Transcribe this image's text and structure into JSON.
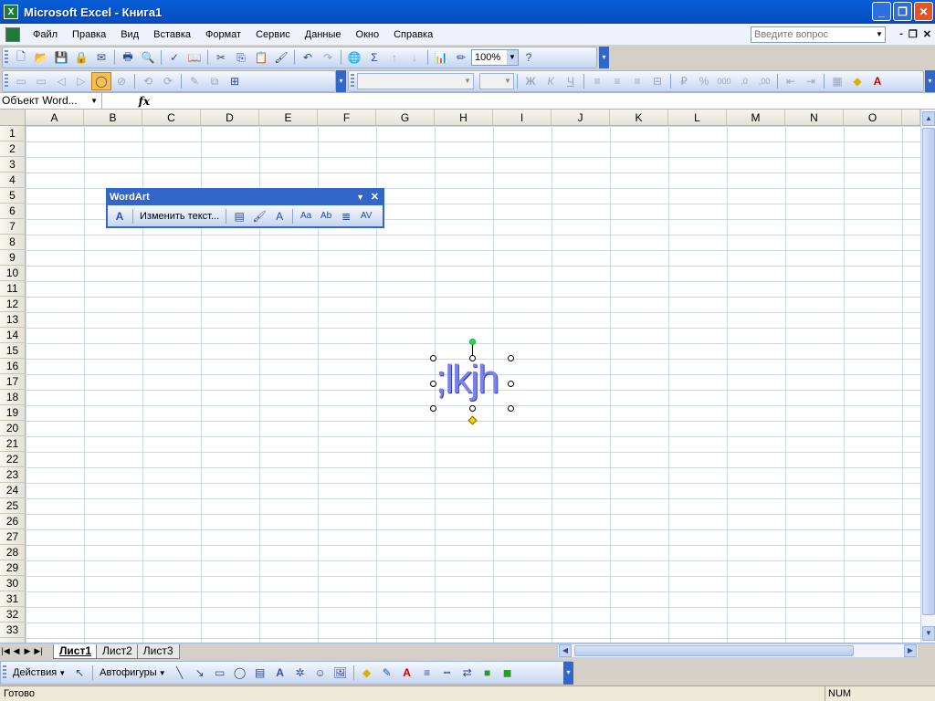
{
  "window": {
    "title": "Microsoft Excel - Книга1",
    "icon": "excel-icon",
    "min": "_",
    "max": "❐",
    "close": "✕"
  },
  "menu": {
    "items": [
      "Файл",
      "Правка",
      "Вид",
      "Вставка",
      "Формат",
      "Сервис",
      "Данные",
      "Окно",
      "Справка"
    ],
    "ask_placeholder": "Введите вопрос",
    "mdi_min": "-",
    "mdi_restore": "❐",
    "mdi_close": "✕"
  },
  "standard_toolbar": {
    "zoom": "100%"
  },
  "formula_bar": {
    "name_box": "Объект Word...",
    "fx": "fx",
    "formula": ""
  },
  "grid": {
    "columns": [
      "A",
      "B",
      "C",
      "D",
      "E",
      "F",
      "G",
      "H",
      "I",
      "J",
      "K",
      "L",
      "M",
      "N",
      "O"
    ],
    "rows": [
      "1",
      "2",
      "3",
      "4",
      "5",
      "6",
      "7",
      "8",
      "9",
      "10",
      "11",
      "12",
      "13",
      "14",
      "15",
      "16",
      "17",
      "18",
      "19",
      "20",
      "21",
      "22",
      "23",
      "24",
      "25",
      "26",
      "27",
      "28",
      "29",
      "30",
      "31",
      "32",
      "33"
    ]
  },
  "wordart_toolbar": {
    "title": "WordArt",
    "edit_text": "Изменить текст..."
  },
  "wordart_object": {
    "text": ";lkjh",
    "color": "#7b82ee"
  },
  "sheets": {
    "tabs": [
      "Лист1",
      "Лист2",
      "Лист3"
    ],
    "active": "Лист1"
  },
  "drawing_toolbar": {
    "actions": "Действия",
    "autoshapes": "Автофигуры"
  },
  "status": {
    "text": "Готово",
    "num": "NUM"
  },
  "colors": {
    "titlebar": "#0553c8",
    "toolbar": "#c6d6f2",
    "gridline": "#d0d7e5",
    "wordart_fill": "#7b82ee"
  }
}
